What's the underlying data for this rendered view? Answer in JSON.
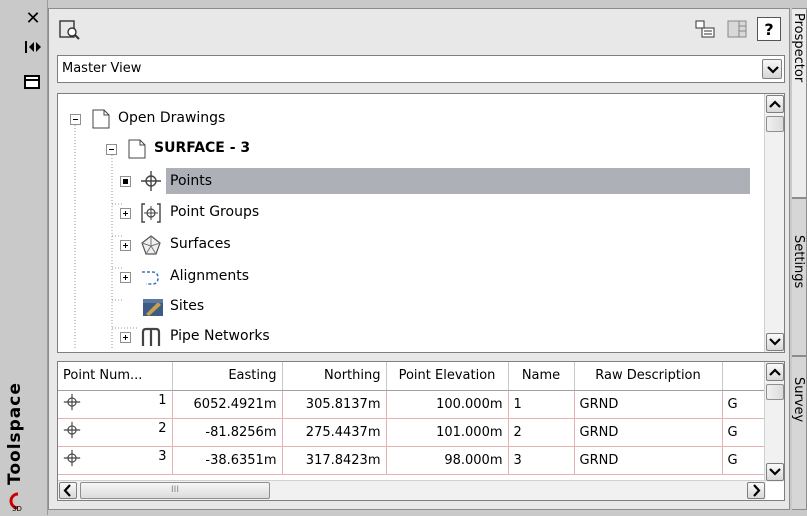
{
  "window": {
    "title": "Toolspace",
    "close_glyph": "✕"
  },
  "toolbar": {
    "buttons": [
      "zoom-extents-icon",
      "item-view-icon",
      "list-view-icon",
      "help-icon"
    ],
    "help_glyph": "?"
  },
  "view_selector": {
    "value": "Master View"
  },
  "tree": {
    "items": [
      {
        "label": "Open Drawings",
        "level": 0,
        "expander": "minus",
        "icon": "drawings-icon",
        "bold": false,
        "selected": false
      },
      {
        "label": "SURFACE - 3",
        "level": 1,
        "expander": "minus",
        "icon": "drawing-icon",
        "bold": true,
        "selected": false
      },
      {
        "label": "Points",
        "level": 2,
        "expander": "dot",
        "icon": "point-icon",
        "bold": false,
        "selected": true
      },
      {
        "label": "Point Groups",
        "level": 2,
        "expander": "plus",
        "icon": "point-group-icon",
        "bold": false,
        "selected": false
      },
      {
        "label": "Surfaces",
        "level": 2,
        "expander": "plus",
        "icon": "surface-icon",
        "bold": false,
        "selected": false
      },
      {
        "label": "Alignments",
        "level": 2,
        "expander": "plus",
        "icon": "alignment-icon",
        "bold": false,
        "selected": false
      },
      {
        "label": "Sites",
        "level": 2,
        "expander": "none",
        "icon": "site-icon",
        "bold": false,
        "selected": false
      },
      {
        "label": "Pipe Networks",
        "level": 2,
        "expander": "plus",
        "icon": "pipe-network-icon",
        "bold": false,
        "selected": false
      }
    ]
  },
  "points_table": {
    "columns": [
      "Point Num...",
      "Easting",
      "Northing",
      "Point Elevation",
      "Name",
      "Raw Description",
      ""
    ],
    "rows": [
      {
        "number": "1",
        "easting": "6052.4921m",
        "northing": "305.8137m",
        "elevation": "100.000m",
        "name": "1",
        "raw_description": "GRND",
        "extra": "G"
      },
      {
        "number": "2",
        "easting": "-81.8256m",
        "northing": "275.4437m",
        "elevation": "101.000m",
        "name": "2",
        "raw_description": "GRND",
        "extra": "G"
      },
      {
        "number": "3",
        "easting": "-38.6351m",
        "northing": "317.8423m",
        "elevation": "98.000m",
        "name": "3",
        "raw_description": "GRND",
        "extra": "G"
      }
    ],
    "hscroll_grip": "III"
  },
  "side_tabs": [
    "Prospector",
    "Settings",
    "Survey"
  ],
  "colors": {
    "selection": "#aeb0b8",
    "grid_line": "#e6b3b3",
    "panel": "#e8e8e8"
  }
}
